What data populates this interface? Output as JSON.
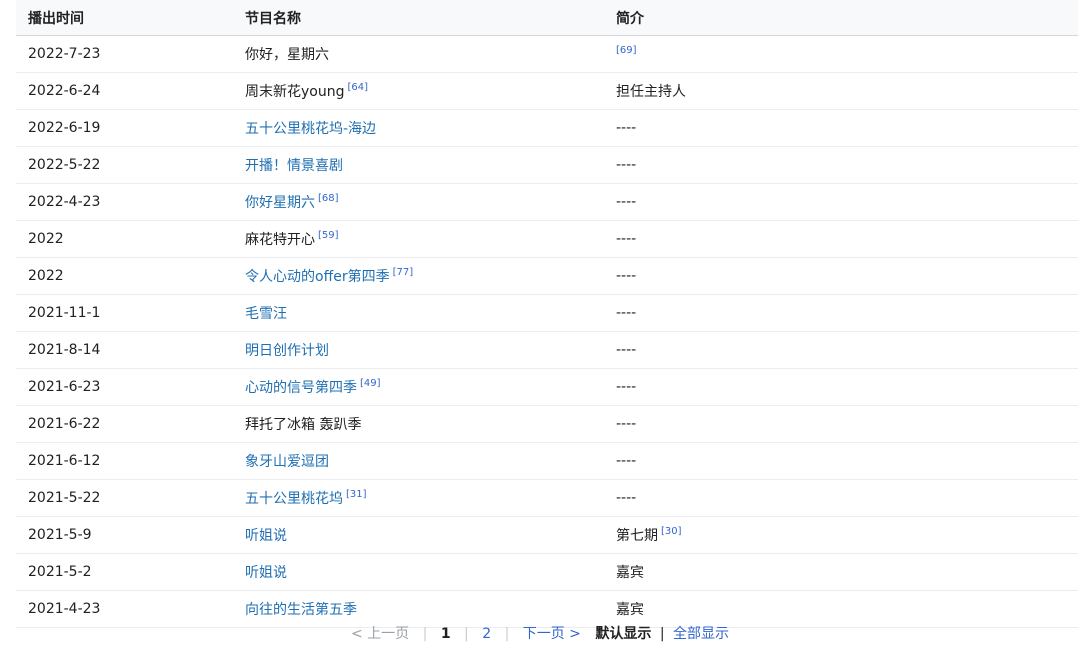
{
  "table": {
    "headers": [
      "播出时间",
      "节目名称",
      "简介"
    ],
    "rows": [
      {
        "date": "2022-7-23",
        "title": "你好，星期六",
        "title_link": false,
        "title_ref": "",
        "note": "",
        "note_ref": "[69]"
      },
      {
        "date": "2022-6-24",
        "title": "周末新花young",
        "title_link": false,
        "title_ref": "[64]",
        "note": "担任主持人",
        "note_ref": ""
      },
      {
        "date": "2022-6-19",
        "title": "五十公里桃花坞-海边",
        "title_link": true,
        "title_ref": "",
        "note": "----",
        "note_ref": ""
      },
      {
        "date": "2022-5-22",
        "title": "开播！情景喜剧",
        "title_link": true,
        "title_ref": "",
        "note": "----",
        "note_ref": ""
      },
      {
        "date": "2022-4-23",
        "title": "你好星期六",
        "title_link": true,
        "title_ref": "[68]",
        "note": "----",
        "note_ref": ""
      },
      {
        "date": "2022",
        "title": "麻花特开心",
        "title_link": false,
        "title_ref": "[59]",
        "note": "----",
        "note_ref": ""
      },
      {
        "date": "2022",
        "title": "令人心动的offer第四季",
        "title_link": true,
        "title_ref": "[77]",
        "note": "----",
        "note_ref": ""
      },
      {
        "date": "2021-11-1",
        "title": "毛雪汪",
        "title_link": true,
        "title_ref": "",
        "note": "----",
        "note_ref": ""
      },
      {
        "date": "2021-8-14",
        "title": "明日创作计划",
        "title_link": true,
        "title_ref": "",
        "note": "----",
        "note_ref": ""
      },
      {
        "date": "2021-6-23",
        "title": "心动的信号第四季",
        "title_link": true,
        "title_ref": "[49]",
        "note": "----",
        "note_ref": ""
      },
      {
        "date": "2021-6-22",
        "title": "拜托了冰箱 轰趴季",
        "title_link": false,
        "title_ref": "",
        "note": "----",
        "note_ref": ""
      },
      {
        "date": "2021-6-12",
        "title": "象牙山爱逗团",
        "title_link": true,
        "title_ref": "",
        "note": "----",
        "note_ref": ""
      },
      {
        "date": "2021-5-22",
        "title": "五十公里桃花坞",
        "title_link": true,
        "title_ref": "[31]",
        "note": "----",
        "note_ref": ""
      },
      {
        "date": "2021-5-9",
        "title": "听姐说",
        "title_link": true,
        "title_ref": "",
        "note": "第七期",
        "note_ref": "[30]"
      },
      {
        "date": "2021-5-2",
        "title": "听姐说",
        "title_link": true,
        "title_ref": "",
        "note": "嘉宾",
        "note_ref": ""
      },
      {
        "date": "2021-4-23",
        "title": "向往的生活第五季",
        "title_link": true,
        "title_ref": "",
        "note": "嘉宾",
        "note_ref": ""
      }
    ]
  },
  "pager": {
    "prev": "< 上一页",
    "sep": "|",
    "page1": "1",
    "page2": "2",
    "next": "下一页 >",
    "default_view": "默认显示",
    "bar": "|",
    "show_all": "全部显示"
  },
  "colors": {
    "link": "#1f6fb2",
    "ref": "#3366cc",
    "muted": "#9aa0a6"
  }
}
